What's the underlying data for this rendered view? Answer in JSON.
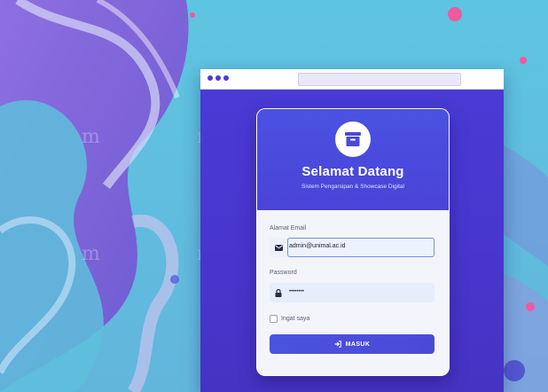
{
  "login": {
    "title": "Selamat Datang",
    "subtitle": "Sistem Pengarsipan & Showcase Digital",
    "email_label": "Alamat Email",
    "email_value": "admin@unimal.ac.id",
    "password_label": "Password",
    "password_value": "••••••••",
    "remember_label": "Ingat saya",
    "submit_label": "MASUK"
  },
  "icons": {
    "logo": "archive-box-icon",
    "email": "envelope-icon",
    "password": "lock-icon",
    "submit": "sign-in-icon"
  },
  "colors": {
    "primary": "#4a4ad8",
    "card_background": "#f4f5fb",
    "browser_background": "#4633c4"
  }
}
